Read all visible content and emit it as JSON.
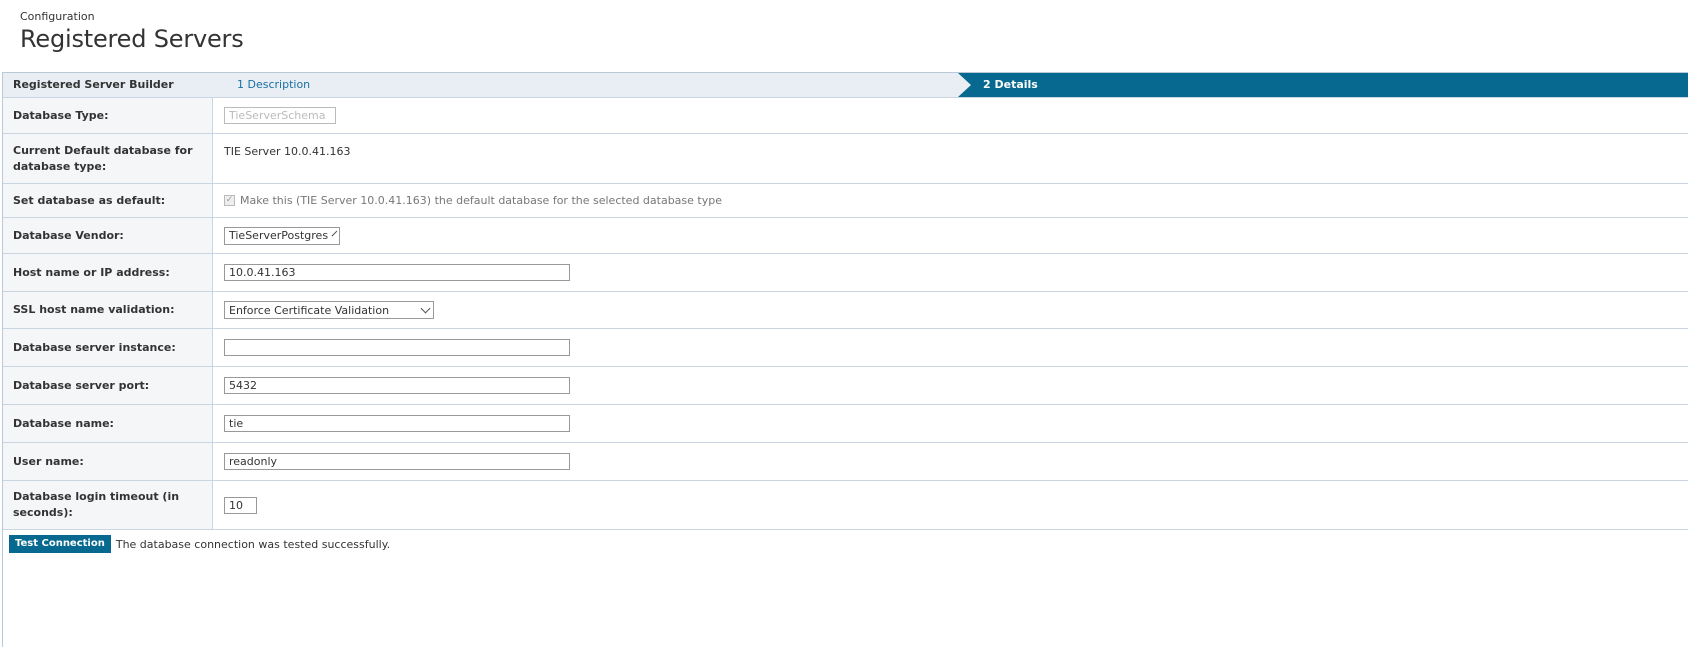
{
  "header": {
    "breadcrumb": "Configuration",
    "title": "Registered Servers"
  },
  "builder": {
    "title": "Registered Server Builder",
    "step1": "1 Description",
    "step2": "2 Details"
  },
  "form": {
    "database_type": {
      "label": "Database Type:",
      "value": "TieServerSchema"
    },
    "current_default": {
      "label": "Current Default database for database type:",
      "value": "TIE Server 10.0.41.163"
    },
    "set_default": {
      "label": "Set database as default:",
      "checkbox_text": "Make this (TIE Server 10.0.41.163) the default database for the selected database type",
      "checked": true
    },
    "vendor": {
      "label": "Database Vendor:",
      "value": "TieServerPostgres"
    },
    "host": {
      "label": "Host name or IP address:",
      "value": "10.0.41.163"
    },
    "ssl": {
      "label": "SSL host name validation:",
      "value": "Enforce Certificate Validation"
    },
    "instance": {
      "label": "Database server instance:",
      "value": ""
    },
    "port": {
      "label": "Database server port:",
      "value": "5432"
    },
    "db_name": {
      "label": "Database name:",
      "value": "tie"
    },
    "user": {
      "label": "User name:",
      "value": "readonly"
    },
    "timeout": {
      "label": "Database login timeout (in seconds):",
      "value": "10"
    }
  },
  "actions": {
    "test_button": "Test Connection",
    "status_message": "The database connection was tested successfully."
  },
  "colors": {
    "accent": "#07698f",
    "link": "#1a6fa3",
    "label_bg": "#f4f6f8",
    "border": "#c9d6e1"
  }
}
